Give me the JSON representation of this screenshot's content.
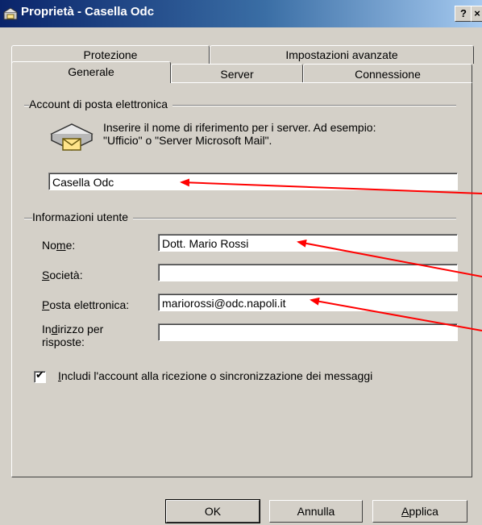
{
  "window": {
    "title": "Proprietà - Casella Odc",
    "help_button": "?",
    "close_button": "×"
  },
  "tabs": {
    "row_back": [
      "Protezione",
      "Impostazioni avanzate"
    ],
    "row_front": [
      "Generale",
      "Server",
      "Connessione"
    ],
    "active": "Generale"
  },
  "account_section": {
    "title": "Account di posta elettronica",
    "description_line1": "Inserire il nome di riferimento per i server. Ad esempio:",
    "description_line2": "\"Ufficio\" o \"Server Microsoft Mail\".",
    "account_name_value": "Casella Odc"
  },
  "user_section": {
    "title": "Informazioni utente",
    "name_label_pre": "No",
    "name_label_u": "m",
    "name_label_post": "e:",
    "name_value": "Dott. Mario Rossi",
    "company_label_u": "S",
    "company_label_post": "ocietà:",
    "company_value": "",
    "email_label_u": "P",
    "email_label_post": "osta elettronica:",
    "email_value": "mariorossi@odc.napoli.it",
    "reply_label_pre": "In",
    "reply_label_u": "d",
    "reply_label_post": "irizzo per",
    "reply_label_line2": "risposte:",
    "reply_value": ""
  },
  "include_checkbox": {
    "checked": true,
    "label_u": "I",
    "label_post": "ncludi l'account alla ricezione o sincronizzazione dei messaggi"
  },
  "buttons": {
    "ok": "OK",
    "cancel": "Annulla",
    "apply_u": "A",
    "apply_post": "pplica"
  },
  "colors": {
    "annotation_arrow": "#ff0000",
    "dialog_face": "#d4d0c8",
    "titlebar": "#0a246a"
  }
}
